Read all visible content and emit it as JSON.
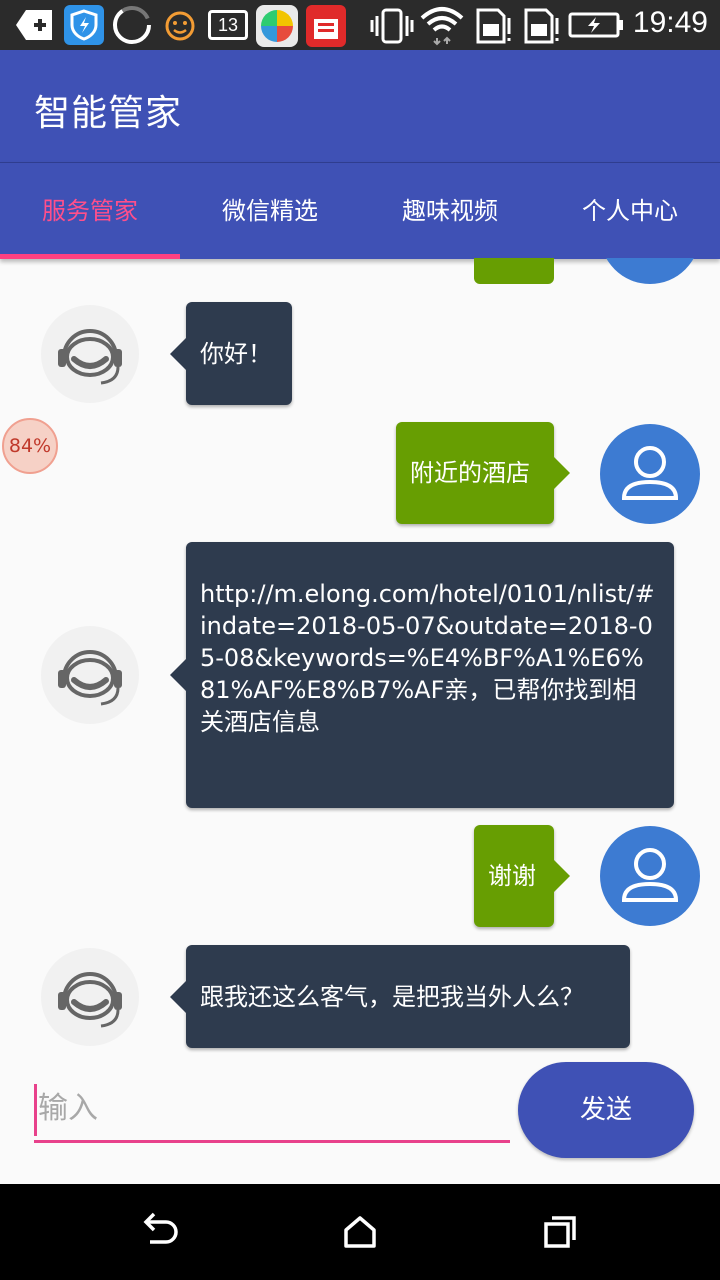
{
  "status_bar": {
    "time": "19:49",
    "badge_count": "13",
    "icons": [
      "add-icon",
      "shield-icon",
      "loading-ring-icon",
      "face-icon",
      "badge-count-icon",
      "pinwheel-app-icon",
      "red-app-icon",
      "vibrate-icon",
      "wifi-icon",
      "sim1-icon",
      "sim2-icon",
      "battery-icon"
    ]
  },
  "app_bar": {
    "title": "智能管家"
  },
  "tabs": [
    {
      "label": "服务管家",
      "active": true
    },
    {
      "label": "微信精选",
      "active": false
    },
    {
      "label": "趣味视频",
      "active": false
    },
    {
      "label": "个人中心",
      "active": false
    }
  ],
  "chat": {
    "messages": [
      {
        "from": "bot",
        "text": "你好！"
      },
      {
        "from": "user",
        "text": "附近的酒店"
      },
      {
        "from": "bot",
        "text": "http://m.elong.com/hotel/0101/nlist/#indate=2018-05-07&outdate=2018-05-08&keywords=%E4%BF%A1%E6%81%AF%E8%B7%AF亲，已帮你找到相关酒店信息"
      },
      {
        "from": "user",
        "text": "谢谢"
      },
      {
        "from": "bot",
        "text": "跟我还这么客气，是把我当外人么？"
      }
    ]
  },
  "floating_ball": {
    "percent": "84%"
  },
  "input": {
    "placeholder": "输入",
    "value": ""
  },
  "send_button": {
    "label": "发送"
  },
  "nav_bar": {
    "icons": [
      "back-icon",
      "home-icon",
      "recents-icon"
    ]
  },
  "colors": {
    "primary": "#3f51b5",
    "accent": "#ff4081",
    "bot_bubble": "#2e3b4e",
    "user_bubble": "#679e02",
    "user_avatar": "#3d7bd2"
  }
}
